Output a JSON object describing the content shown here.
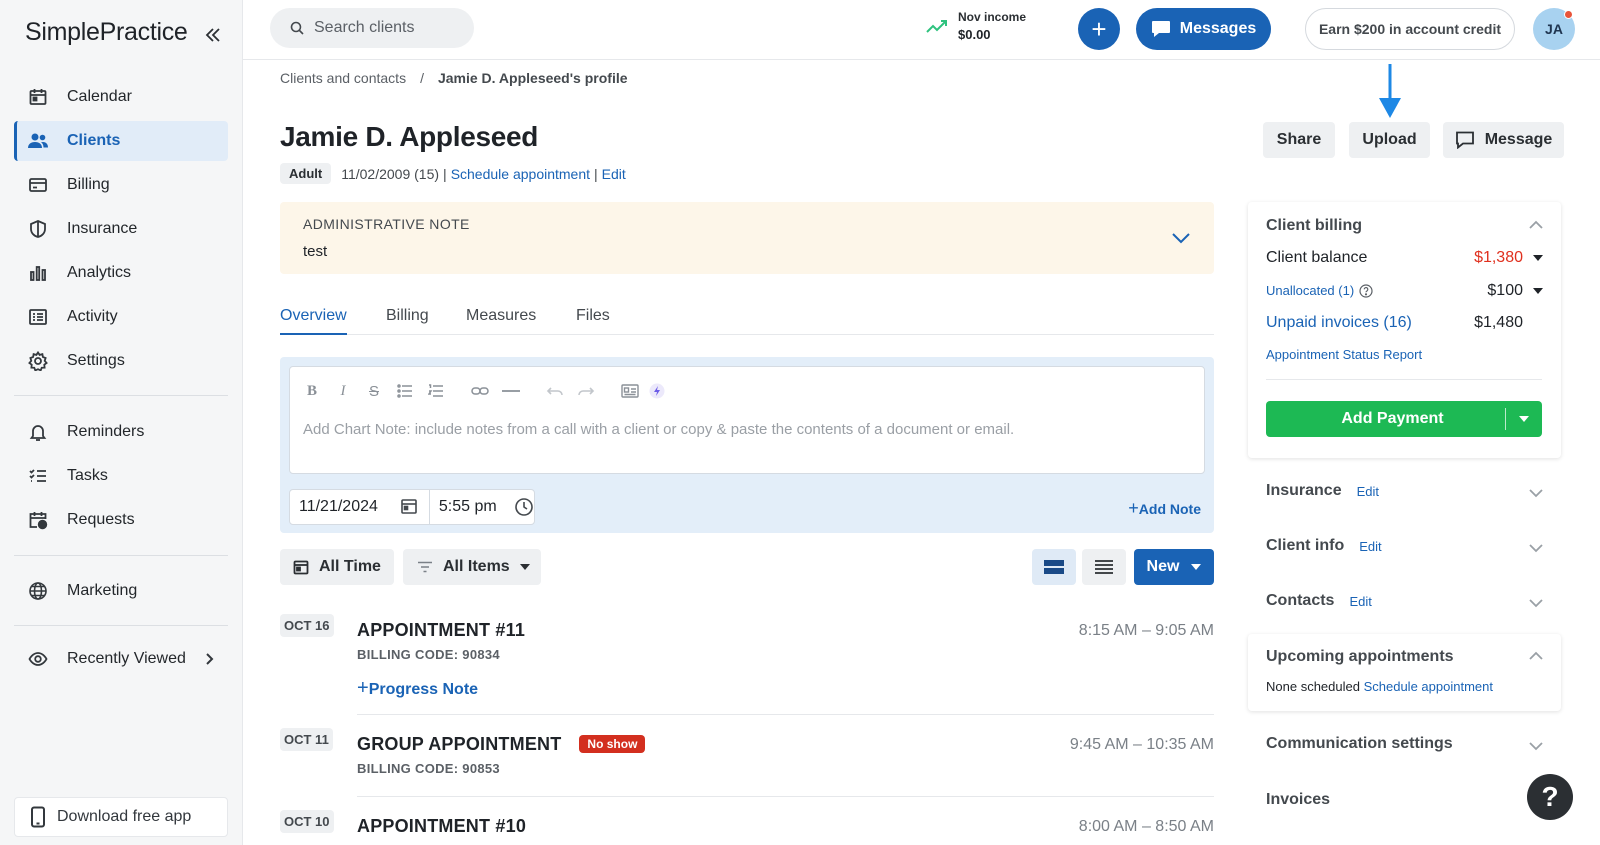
{
  "app": {
    "logo_text": "SimplePractice"
  },
  "sidebar": {
    "items": [
      {
        "label": "Calendar",
        "icon": "calendar-icon"
      },
      {
        "label": "Clients",
        "icon": "clients-icon",
        "active": true
      },
      {
        "label": "Billing",
        "icon": "credit-card-icon"
      },
      {
        "label": "Insurance",
        "icon": "shield-icon"
      },
      {
        "label": "Analytics",
        "icon": "bar-chart-icon"
      },
      {
        "label": "Activity",
        "icon": "list-icon"
      },
      {
        "label": "Settings",
        "icon": "gear-icon"
      },
      {
        "label": "Reminders",
        "icon": "bell-icon"
      },
      {
        "label": "Tasks",
        "icon": "checklist-icon"
      },
      {
        "label": "Requests",
        "icon": "calendar-clock-icon"
      },
      {
        "label": "Marketing",
        "icon": "globe-icon"
      },
      {
        "label": "Recently Viewed",
        "icon": "eye-icon"
      }
    ],
    "download_label": "Download free app"
  },
  "topbar": {
    "search_placeholder": "Search clients",
    "income_label": "Nov income",
    "income_value": "$0.00",
    "messages_label": "Messages",
    "credit_label": "Earn $200 in account credit",
    "avatar_initials": "JA"
  },
  "breadcrumb": {
    "parent": "Clients and contacts",
    "separator": "/",
    "current": "Jamie D. Appleseed's profile"
  },
  "client": {
    "name": "Jamie D. Appleseed",
    "type_badge": "Adult",
    "dob": "11/02/2009 (15)",
    "pipe": "|",
    "schedule_link": "Schedule appointment",
    "edit_link": "Edit"
  },
  "actions": {
    "share": "Share",
    "upload": "Upload",
    "message": "Message"
  },
  "admin_note": {
    "heading": "ADMINISTRATIVE NOTE",
    "text": "test"
  },
  "tabs": [
    "Overview",
    "Billing",
    "Measures",
    "Files"
  ],
  "chart_note": {
    "placeholder": "Add Chart Note: include notes from a call with a client or copy & paste the contents of a document or email.",
    "date": "11/21/2024",
    "time": "5:55 pm",
    "add_note": "Add Note"
  },
  "filters": {
    "time": "All Time",
    "items": "All Items",
    "new": "New"
  },
  "appointments": [
    {
      "date": "OCT 16",
      "title": "APPOINTMENT #11",
      "billing_code": "BILLING CODE: 90834",
      "time": "8:15 AM – 9:05 AM",
      "action": "Progress Note"
    },
    {
      "date": "OCT 11",
      "title": "GROUP APPOINTMENT",
      "badge": "No show",
      "billing_code": "BILLING CODE: 90853",
      "time": "9:45 AM – 10:35 AM"
    },
    {
      "date": "OCT 10",
      "title": "APPOINTMENT #10",
      "time": "8:00 AM – 8:50 AM"
    }
  ],
  "billing": {
    "heading": "Client billing",
    "balance_label": "Client balance",
    "balance_value": "$1,380",
    "unallocated_label": "Unallocated (1)",
    "unallocated_value": "$100",
    "unpaid_label": "Unpaid invoices (16)",
    "unpaid_value": "$1,480",
    "report_link": "Appointment Status Report",
    "add_payment": "Add Payment",
    "balance_color": "#e0301e",
    "add_payment_color": "#1db954"
  },
  "right_sections": {
    "insurance": "Insurance",
    "client_info": "Client info",
    "contacts": "Contacts",
    "edit": "Edit",
    "upcoming": "Upcoming appointments",
    "none_scheduled": "None scheduled",
    "schedule_link": "Schedule appointment",
    "communication": "Communication settings",
    "invoices": "Invoices"
  },
  "help": "?"
}
